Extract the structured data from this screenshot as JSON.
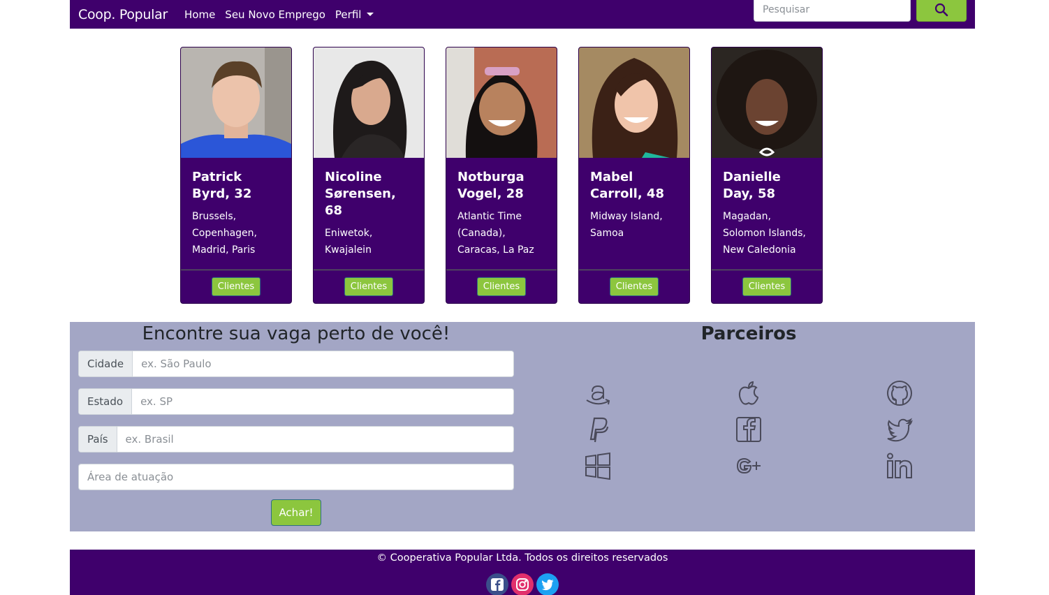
{
  "navbar": {
    "brand": "Coop. Popular",
    "links": [
      "Home",
      "Seu Novo Emprego",
      "Perfil"
    ],
    "search_placeholder": "Pesquisar",
    "search_icon": "search-icon"
  },
  "cards": [
    {
      "name": "Patrick Byrd, 32",
      "location": "Brussels, Copenhagen, Madrid, Paris",
      "button": "Clientes"
    },
    {
      "name": "Nicoline Sørensen, 68",
      "location": "Eniwetok, Kwajalein",
      "button": "Clientes"
    },
    {
      "name": "Notburga Vogel, 28",
      "location": "Atlantic Time (Canada), Caracas, La Paz",
      "button": "Clientes"
    },
    {
      "name": "Mabel Carroll, 48",
      "location": "Midway Island, Samoa",
      "button": "Clientes"
    },
    {
      "name": "Danielle Day, 58",
      "location": "Magadan, Solomon Islands, New Caledonia",
      "button": "Clientes"
    }
  ],
  "finder": {
    "title": "Encontre sua vaga perto de você!",
    "fields": [
      {
        "label": "Cidade",
        "placeholder": "ex. São Paulo"
      },
      {
        "label": "Estado",
        "placeholder": "ex. SP"
      },
      {
        "label": "País",
        "placeholder": "ex. Brasil"
      }
    ],
    "area_placeholder": "Área de atuação",
    "button": "Achar!"
  },
  "partners": {
    "title": "Parceiros",
    "icons": [
      "amazon-icon",
      "apple-icon",
      "github-icon",
      "paypal-icon",
      "facebook-icon",
      "twitter-icon",
      "windows-icon",
      "google-plus-icon",
      "linkedin-icon"
    ]
  },
  "footer": {
    "text": "© Cooperativa Popular Ltda. Todos os direitos reservados",
    "socials": [
      "facebook-icon",
      "instagram-icon",
      "twitter-icon"
    ]
  },
  "colors": {
    "primary": "#3f006c",
    "accent": "#8cc63e",
    "panel": "#a3a6c5"
  }
}
